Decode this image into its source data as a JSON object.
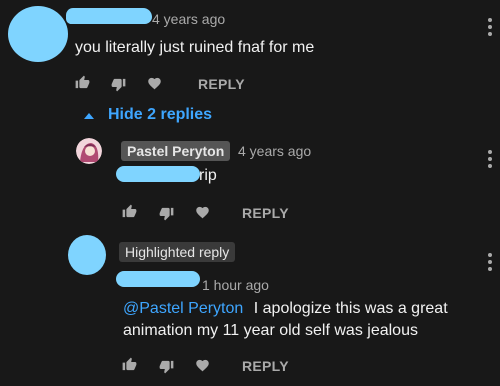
{
  "comments": [
    {
      "time": "4 years ago",
      "text": "you literally just ruined fnaf for me",
      "reply_label": "REPLY"
    },
    {
      "author": "Pastel Peryton",
      "time": "4 years ago",
      "text": "rip",
      "reply_label": "REPLY"
    },
    {
      "badge": "Highlighted reply",
      "time": "1 hour ago",
      "mention": "@Pastel Peryton",
      "text_line1": "I apologize this was a great",
      "text_line2": "animation my 11 year old self was jealous",
      "reply_label": "REPLY"
    }
  ],
  "replies_toggle": {
    "label": "Hide 2 replies"
  },
  "colors": {
    "background": "#181818",
    "text": "#f1f1f1",
    "meta": "#aaaaaa",
    "link": "#3ea6ff",
    "redaction": "#7fd4ff"
  },
  "icons": [
    "thumbs-up-icon",
    "thumbs-down-icon",
    "heart-icon",
    "more-vert-icon",
    "chevron-up-icon",
    "avatar-icon"
  ]
}
